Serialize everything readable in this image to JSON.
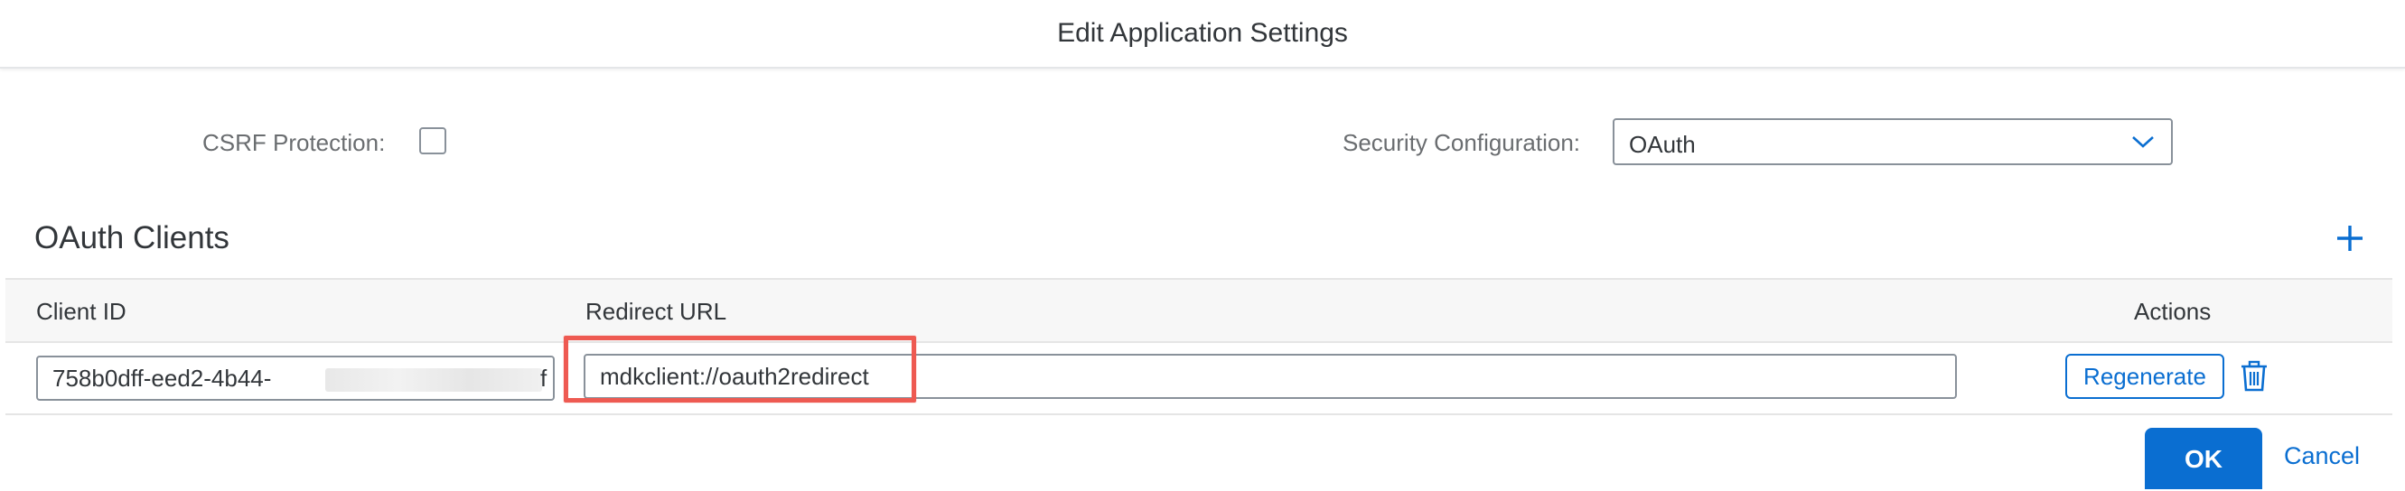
{
  "dialog": {
    "title": "Edit Application Settings"
  },
  "form": {
    "csrf_label": "CSRF Protection:",
    "csrf_checked": false,
    "security_label": "Security Configuration:",
    "security_value": "OAuth"
  },
  "oauth_clients": {
    "title": "OAuth Clients",
    "columns": {
      "client_id": "Client ID",
      "redirect_url": "Redirect URL",
      "actions": "Actions"
    },
    "rows": [
      {
        "client_id_visible_start": "758b0dff-eed2-4b44-",
        "client_id_visible_end": "f",
        "redirect_url": "mdkclient://oauth2redirect",
        "regenerate_label": "Regenerate"
      }
    ]
  },
  "footer": {
    "ok_label": "OK",
    "cancel_label": "Cancel"
  },
  "colors": {
    "accent": "#0a6ed1",
    "highlight": "#ee5a52",
    "label": "#6a6d70",
    "text": "#32363a"
  }
}
